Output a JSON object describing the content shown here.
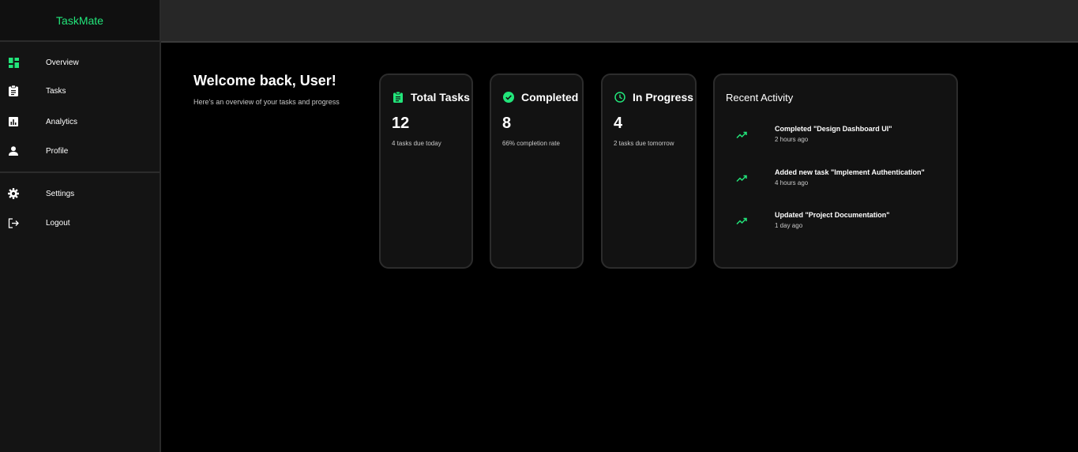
{
  "app": {
    "name": "TaskMate"
  },
  "colors": {
    "accent": "#22e57a",
    "background": "#000000",
    "sidebar": "#141414",
    "card": "#121212",
    "topbar": "#272727"
  },
  "sidebar": {
    "items": [
      {
        "label": "Overview",
        "icon": "dashboard-icon"
      },
      {
        "label": "Tasks",
        "icon": "clipboard-icon"
      },
      {
        "label": "Analytics",
        "icon": "chart-icon"
      },
      {
        "label": "Profile",
        "icon": "person-icon"
      }
    ],
    "bottom_items": [
      {
        "label": "Settings",
        "icon": "gear-icon"
      },
      {
        "label": "Logout",
        "icon": "logout-icon"
      }
    ]
  },
  "welcome": {
    "title": "Welcome back, User!",
    "subtitle": "Here's an overview of your tasks and progress"
  },
  "stats": [
    {
      "title": "Total Tasks",
      "value": "12",
      "note": "4 tasks due today",
      "icon": "clipboard-icon"
    },
    {
      "title": "Completed",
      "value": "8",
      "note": "66% completion rate",
      "icon": "check-circle-icon"
    },
    {
      "title": "In Progress",
      "value": "4",
      "note": "2 tasks due tomorrow",
      "icon": "clock-icon"
    }
  ],
  "activity": {
    "title": "Recent Activity",
    "items": [
      {
        "text": "Completed \"Design Dashboard UI\"",
        "time": "2 hours ago",
        "icon": "trending-up-icon"
      },
      {
        "text": "Added new task \"Implement Authentication\"",
        "time": "4 hours ago",
        "icon": "trending-up-icon"
      },
      {
        "text": "Updated \"Project Documentation\"",
        "time": "1 day ago",
        "icon": "trending-up-icon"
      }
    ]
  }
}
